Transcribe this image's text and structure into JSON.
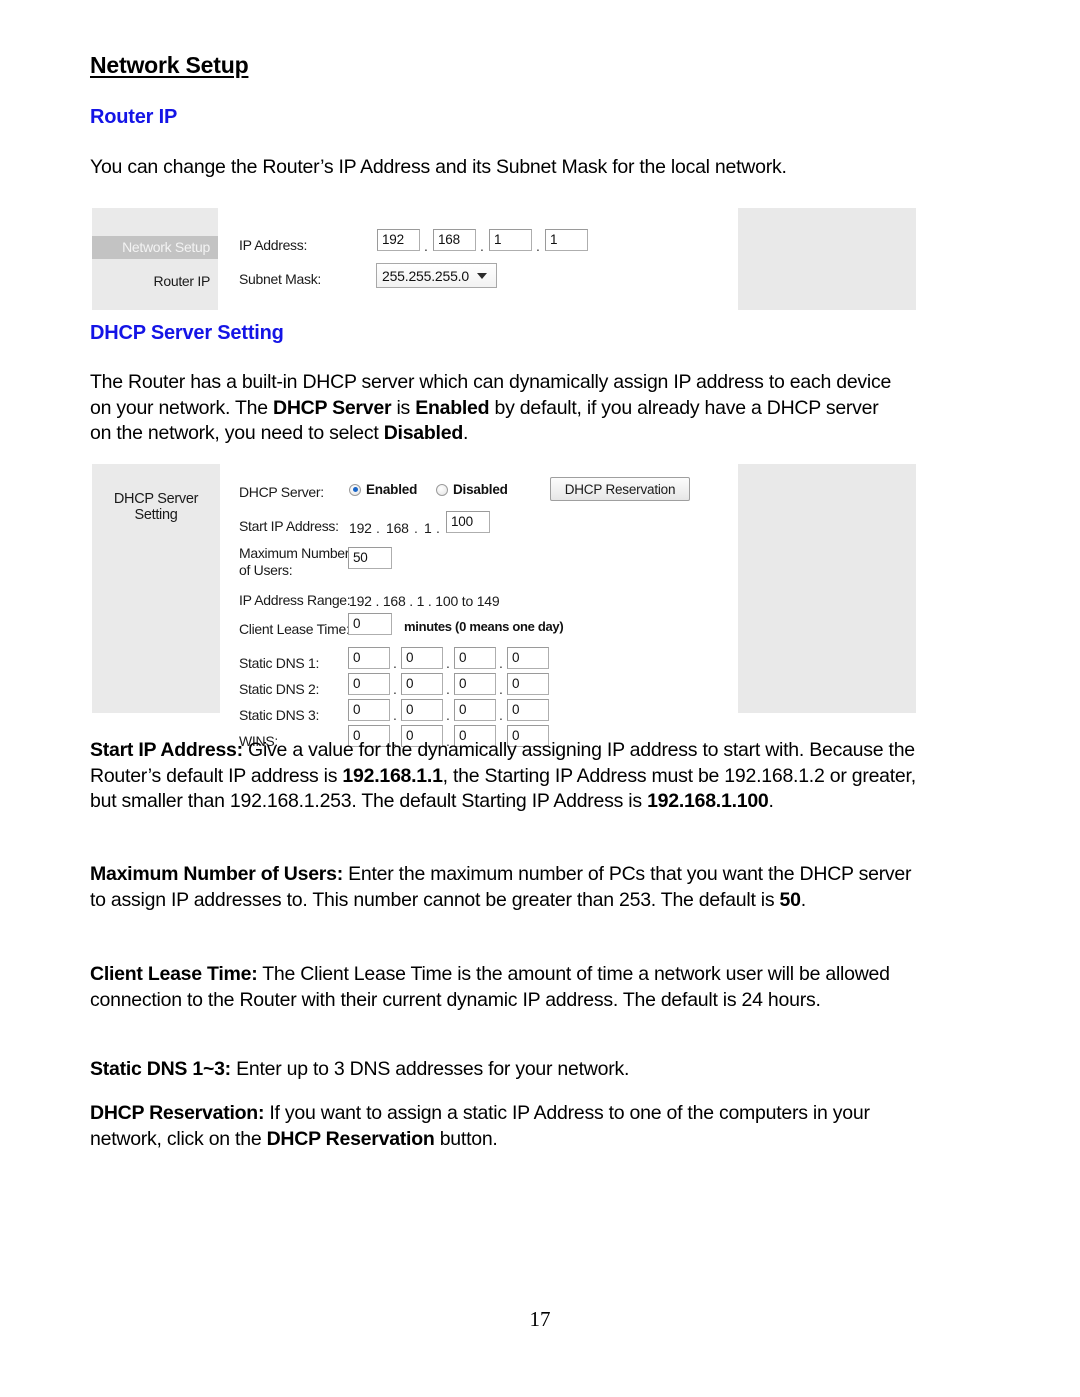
{
  "document": {
    "title": "Network Setup",
    "page_number": "17",
    "sections": [
      {
        "heading": "Router IP",
        "color": "#1414e6"
      },
      {
        "heading": "DHCP Server Setting",
        "color": "#1414e6"
      }
    ],
    "paragraphs": {
      "intro": "You can change the Router’s IP Address and its Subnet Mask for the local network.",
      "dhcp_desc_1": "The Router has a built-in DHCP server which can dynamically assign IP address to each device on your network. The ",
      "dhcp_desc_b1": "DHCP Server",
      "dhcp_desc_2": " is ",
      "dhcp_desc_b2": "Enabled",
      "dhcp_desc_3": " by default, if you already have a DHCP server on the network, you need to select ",
      "dhcp_desc_b3": "Disabled",
      "dhcp_desc_4": ".",
      "start_ip_term": "Start IP Address:",
      "start_ip_1": " Give a value for the dynamically assigning IP address to start with. Because the Router’s default IP address is ",
      "start_ip_b1": "192.168.1.1",
      "start_ip_2": ", the Starting IP Address must be 192.168.1.2 or greater, but smaller than 192.168.1.253. The default Starting IP Address is ",
      "start_ip_b2": "192.168.1.100",
      "start_ip_3": ".",
      "max_users_term": "Maximum Number of Users:",
      "max_users_1": " Enter the maximum number of PCs that you want the DHCP server to assign IP addresses to. This number cannot be greater than 253. The default is ",
      "max_users_b1": "50",
      "max_users_2": ".",
      "lease_term": "Client Lease Time:",
      "lease_1": " The Client Lease Time is the amount of time a network user will be allowed connection to the Router with their current dynamic IP address. The default is 24 hours.",
      "dns_term": "Static DNS 1~3:",
      "dns_1": " Enter up to 3 DNS addresses for your network.",
      "reserve_term": "DHCP Reservation:",
      "reserve_1": " If you want to assign a static IP Address to one of the computers in your network, click on the ",
      "reserve_b1": "DHCP Reservation",
      "reserve_2": " button."
    }
  },
  "screenshot_router_ip": {
    "nav": {
      "active_item": "Network Setup",
      "sub_item": "Router IP"
    },
    "fields": {
      "ip_address_label": "IP Address:",
      "ip_address_octets": [
        "192",
        "168",
        "1",
        "1"
      ],
      "subnet_mask_label": "Subnet Mask:",
      "subnet_mask_value": "255.255.255.0"
    }
  },
  "screenshot_dhcp": {
    "nav": {
      "active_item": "DHCP Server Setting"
    },
    "fields": {
      "dhcp_server_label": "DHCP Server:",
      "enabled_label": "Enabled",
      "disabled_label": "Disabled",
      "dhcp_server_selected": "Enabled",
      "reservation_button": "DHCP Reservation",
      "start_ip_label": "Start IP Address:",
      "start_ip_prefix": [
        "192",
        "168",
        "1"
      ],
      "start_ip_last": "100",
      "max_users_label_line1": "Maximum Number",
      "max_users_label_line2": "of Users:",
      "max_users_value": "50",
      "ip_range_label": "IP Address Range:",
      "ip_range_value": "192 . 168 . 1 . 100 to 149",
      "lease_time_label": "Client Lease Time:",
      "lease_time_value": "0",
      "lease_time_hint": "minutes (0 means one day)",
      "static_dns1_label": "Static DNS 1:",
      "static_dns1_octets": [
        "0",
        "0",
        "0",
        "0"
      ],
      "static_dns2_label": "Static DNS 2:",
      "static_dns2_octets": [
        "0",
        "0",
        "0",
        "0"
      ],
      "static_dns3_label": "Static DNS 3:",
      "static_dns3_octets": [
        "0",
        "0",
        "0",
        "0"
      ],
      "wins_label": "WINS:",
      "wins_octets": [
        "0",
        "0",
        "0",
        "0"
      ]
    }
  }
}
